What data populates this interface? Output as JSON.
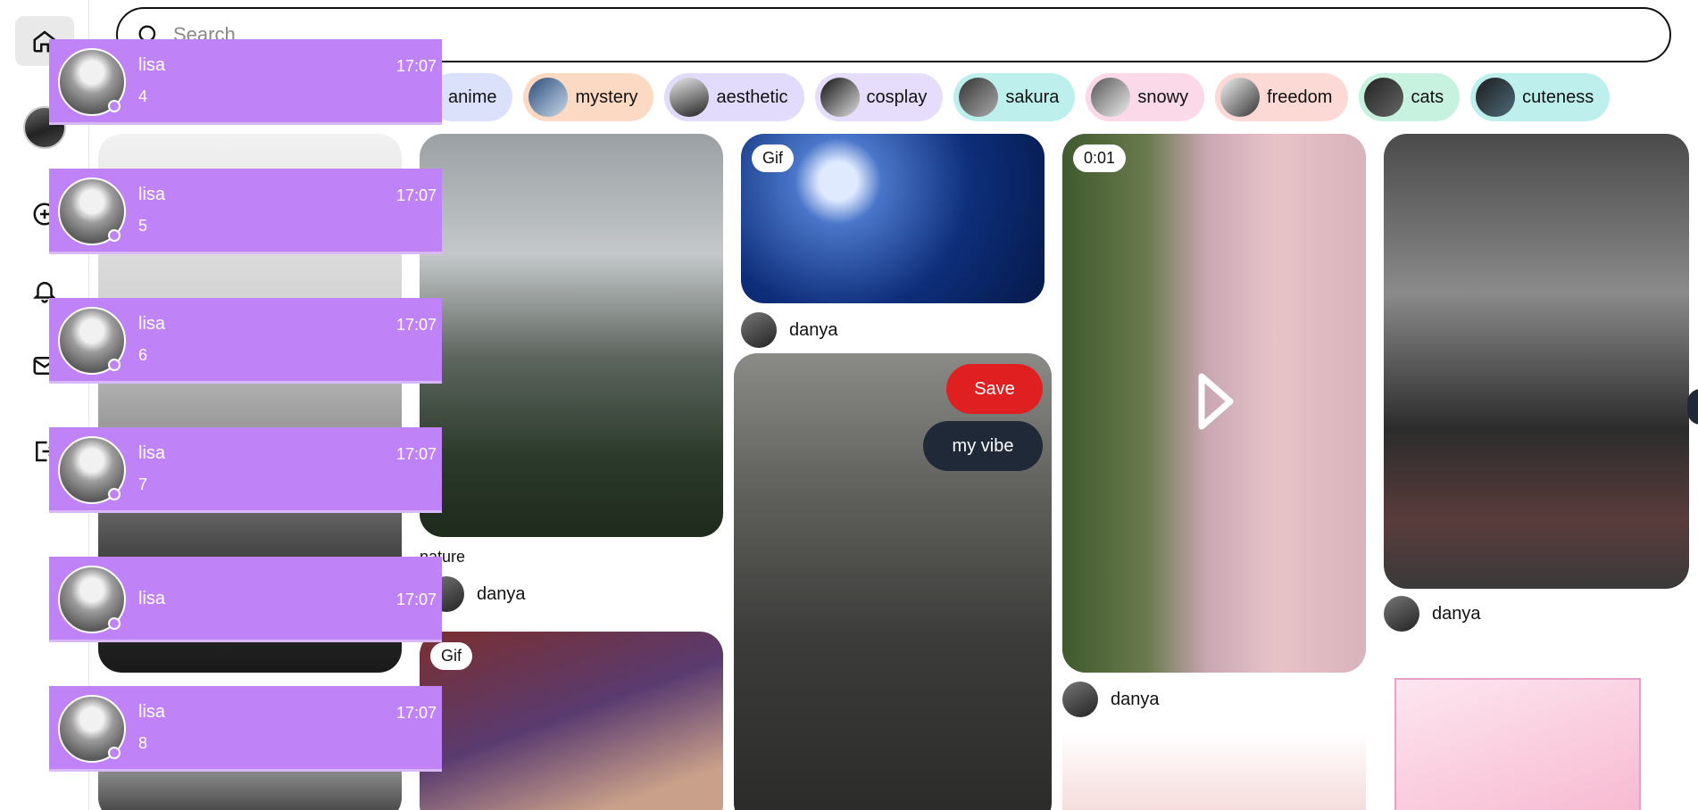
{
  "search": {
    "placeholder": "Search"
  },
  "tags": [
    {
      "label": "anime",
      "color": "#dce1fb"
    },
    {
      "label": "mystery",
      "color": "#fbd9c2"
    },
    {
      "label": "aesthetic",
      "color": "#e3dbfb"
    },
    {
      "label": "cosplay",
      "color": "#e6dcfb"
    },
    {
      "label": "sakura",
      "color": "#bdf0ec"
    },
    {
      "label": "snowy",
      "color": "#fcd9e9"
    },
    {
      "label": "freedom",
      "color": "#fcd9d5"
    },
    {
      "label": "cats",
      "color": "#c7f2df"
    },
    {
      "label": "cuteness",
      "color": "#bdf0ec"
    }
  ],
  "pins": {
    "badge_gif": "Gif",
    "badge_gif_2": "Gif",
    "video_duration": "0:01",
    "nature_title": "nature",
    "author_1": "danya",
    "author_2": "danya",
    "author_3": "danya",
    "author_4": "danya",
    "save_label": "Save",
    "board_label": "my vibe"
  },
  "notifications": [
    {
      "name": "lisa",
      "message": "4",
      "time": "17:07"
    },
    {
      "name": "lisa",
      "message": "5",
      "time": "17:07"
    },
    {
      "name": "lisa",
      "message": "6",
      "time": "17:07"
    },
    {
      "name": "lisa",
      "message": "7",
      "time": "17:07"
    },
    {
      "name": "lisa",
      "message": "",
      "time": "17:07"
    },
    {
      "name": "lisa",
      "message": "8",
      "time": "17:07"
    }
  ]
}
